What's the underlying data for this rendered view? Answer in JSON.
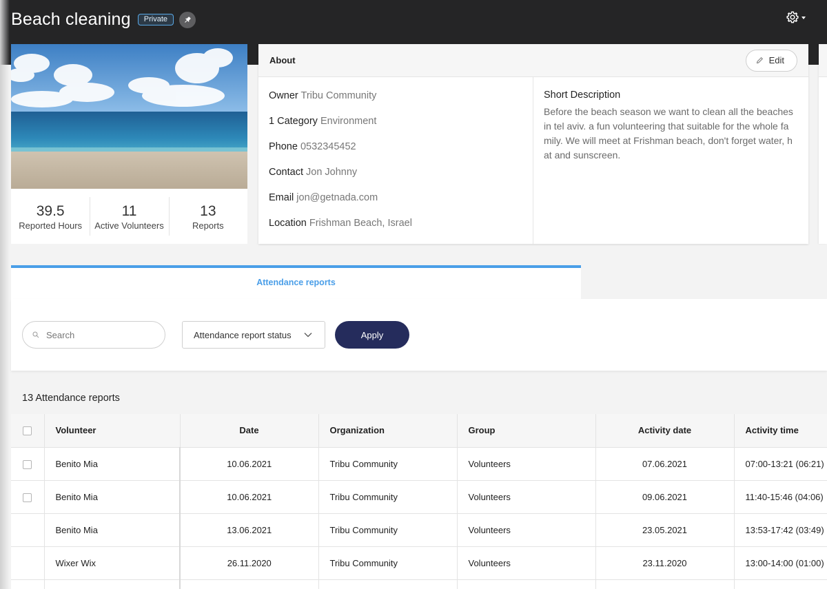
{
  "header": {
    "title": "Beach cleaning",
    "badge": "Private",
    "pin_icon": "pin-icon",
    "settings_icon": "gear-icon"
  },
  "stats": [
    {
      "value": "39.5",
      "label": "Reported Hours"
    },
    {
      "value": "11",
      "label": "Active Volunteers"
    },
    {
      "value": "13",
      "label": "Reports"
    }
  ],
  "about": {
    "title": "About",
    "edit_label": "Edit",
    "fields": [
      {
        "label": "Owner",
        "value": "Tribu Community"
      },
      {
        "label": "1 Category",
        "value": "Environment"
      },
      {
        "label": "Phone",
        "value": "0532345452"
      },
      {
        "label": "Contact",
        "value": "Jon Johnny"
      },
      {
        "label": "Email",
        "value": "jon@getnada.com"
      },
      {
        "label": "Location",
        "value": "Frishman Beach, Israel"
      }
    ],
    "short_description_title": "Short Description",
    "short_description": "Before the beach season we want to clean all the beaches in tel aviv. a fun volunteering that suitable for the whole family. We will meet at Frishman beach, don't forget water, hat and sunscreen."
  },
  "tabs": {
    "active": "Attendance reports"
  },
  "filters": {
    "search_placeholder": "Search",
    "status_label": "Attendance report status",
    "apply_label": "Apply"
  },
  "report_count": "13 Attendance reports",
  "table": {
    "columns": [
      "Volunteer",
      "Date",
      "Organization",
      "Group",
      "Activity date",
      "Activity time"
    ],
    "rows": [
      {
        "volunteer": "Benito Mia",
        "date": "10.06.2021",
        "organization": "Tribu Community",
        "group": "Volunteers",
        "activity_date": "07.06.2021",
        "activity_time": "07:00-13:21 (06:21)",
        "checkbox": true
      },
      {
        "volunteer": "Benito Mia",
        "date": "10.06.2021",
        "organization": "Tribu Community",
        "group": "Volunteers",
        "activity_date": "09.06.2021",
        "activity_time": "11:40-15:46 (04:06)",
        "checkbox": true
      },
      {
        "volunteer": "Benito Mia",
        "date": "13.06.2021",
        "organization": "Tribu Community",
        "group": "Volunteers",
        "activity_date": "23.05.2021",
        "activity_time": "13:53-17:42 (03:49)",
        "checkbox": false
      },
      {
        "volunteer": "Wixer Wix",
        "date": "26.11.2020",
        "organization": "Tribu Community",
        "group": "Volunteers",
        "activity_date": "23.11.2020",
        "activity_time": "13:00-14:00 (01:00)",
        "checkbox": false
      }
    ]
  },
  "colors": {
    "topbar": "#252526",
    "accent": "#4a9ee8",
    "apply_button": "#252c5c"
  }
}
